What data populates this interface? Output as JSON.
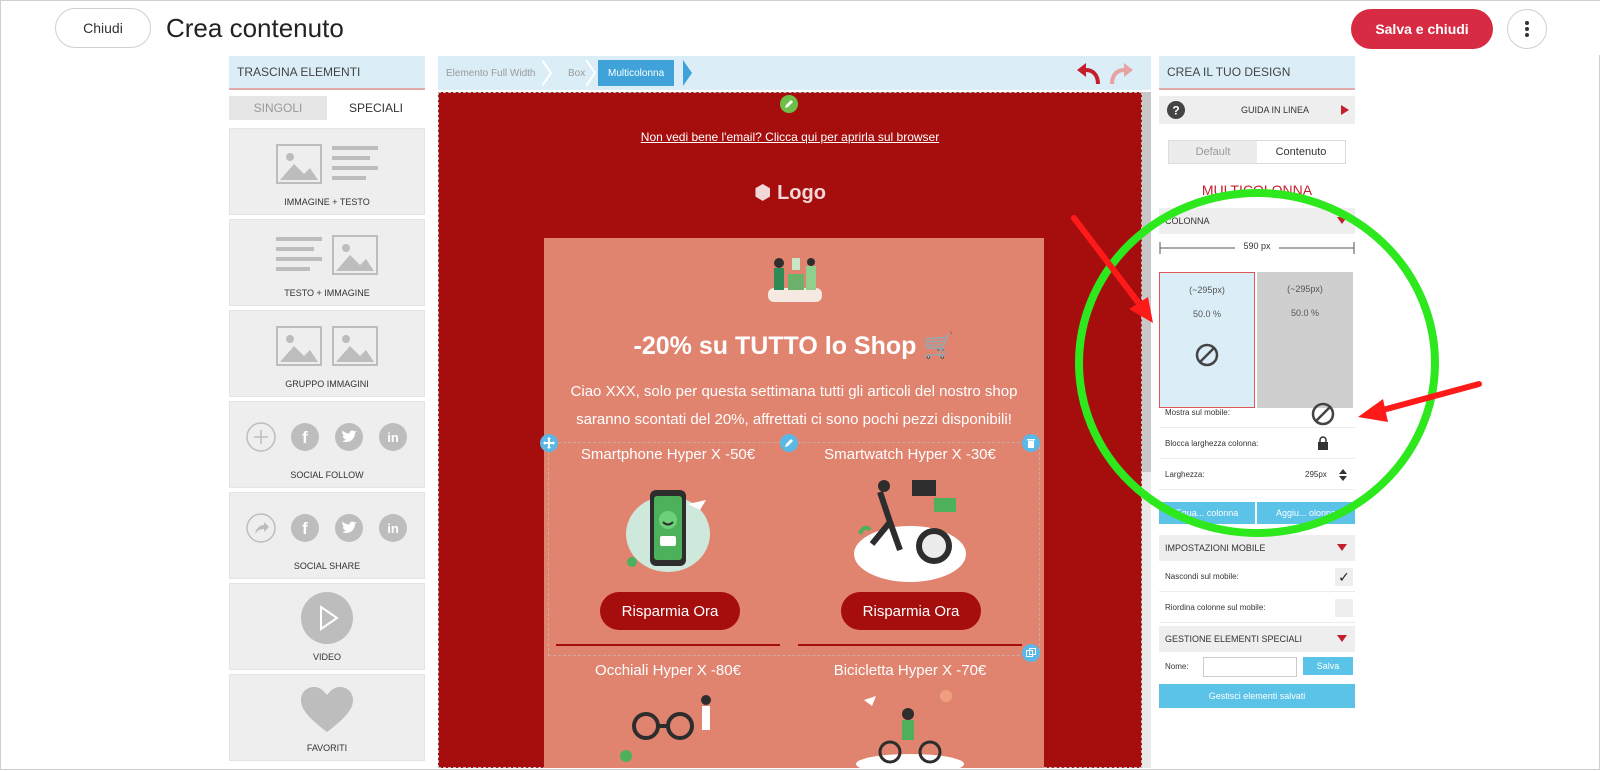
{
  "topbar": {
    "close_label": "Chiudi",
    "title": "Crea contenuto",
    "save_label": "Salva e chiudi",
    "more_icon": "kebab-menu-icon"
  },
  "left_panel": {
    "header": "TRASCINA ELEMENTI",
    "tabs": [
      "SINGOLI",
      "SPECIALI"
    ],
    "active_tab": "SPECIALI",
    "tiles": [
      {
        "label": "IMMAGINE + TESTO",
        "icon": "image-text-icon"
      },
      {
        "label": "TESTO + IMMAGINE",
        "icon": "text-image-icon"
      },
      {
        "label": "GRUPPO IMMAGINI",
        "icon": "image-group-icon"
      },
      {
        "label": "SOCIAL FOLLOW",
        "icon": "social-follow-icon"
      },
      {
        "label": "SOCIAL SHARE",
        "icon": "social-share-icon"
      },
      {
        "label": "VIDEO",
        "icon": "video-play-icon"
      },
      {
        "label": "FAVORITI",
        "icon": "heart-icon"
      }
    ]
  },
  "breadcrumb": {
    "items": [
      "Elemento Full Width",
      "Box",
      "Multicolonna"
    ],
    "active": "Multicolonna"
  },
  "email": {
    "top_link": "Non vedi bene l'email? Clicca qui per aprirla sul browser",
    "logo": "Logo",
    "headline": "-20% su TUTTO lo Shop 🛒",
    "intro": "Ciao XXX, solo per questa settimana tutti gli articoli del nostro shop saranno scontati del 20%, affrettati ci sono pochi pezzi disponibili!",
    "products": [
      {
        "title": "Smartphone Hyper X -50€",
        "cta": "Risparmia Ora"
      },
      {
        "title": "Smartwatch Hyper X -30€",
        "cta": "Risparmia Ora"
      },
      {
        "title": "Occhiali Hyper X -80€"
      },
      {
        "title": "Bicicletta Hyper X -70€"
      }
    ]
  },
  "right_panel": {
    "header": "CREA IL TUO DESIGN",
    "guide": "GUIDA IN LINEA",
    "seg": [
      "Default",
      "Contenuto"
    ],
    "active_seg": "Contenuto",
    "section_title": "MULTICOLONNA",
    "colonna_hd": "COLONNA",
    "total_width": "590 px",
    "columns": [
      {
        "px": "(~295px)",
        "pct": "50.0 %"
      },
      {
        "px": "(~295px)",
        "pct": "50.0 %"
      }
    ],
    "fields": [
      {
        "label": "Mostra sul mobile:"
      },
      {
        "label": "Blocca larghezza colonna:"
      },
      {
        "label": "Larghezza:",
        "value": "295px"
      }
    ],
    "btn_equalize": "Equa... colonna",
    "btn_add": "Aggiu... olonna",
    "mobile_hd": "IMPOSTAZIONI MOBILE",
    "mobile_fields": [
      {
        "label": "Nascondi sul mobile:",
        "checked": "✓"
      },
      {
        "label": "Riordina colonne sul mobile:"
      }
    ],
    "special_hd": "GESTIONE ELEMENTI SPECIALI",
    "name_label": "Nome:",
    "save_btn": "Salva",
    "manage_btn": "Gestisci elementi salvati"
  },
  "colors": {
    "accent_red": "#d62b43",
    "email_red": "#a60e0e",
    "card_salmon": "#e0836f",
    "panel_blue": "#dbeef8",
    "selection_blue": "#5bc2e8",
    "annotation_green": "#2ee81e",
    "annotation_red": "#ff1a1a"
  }
}
